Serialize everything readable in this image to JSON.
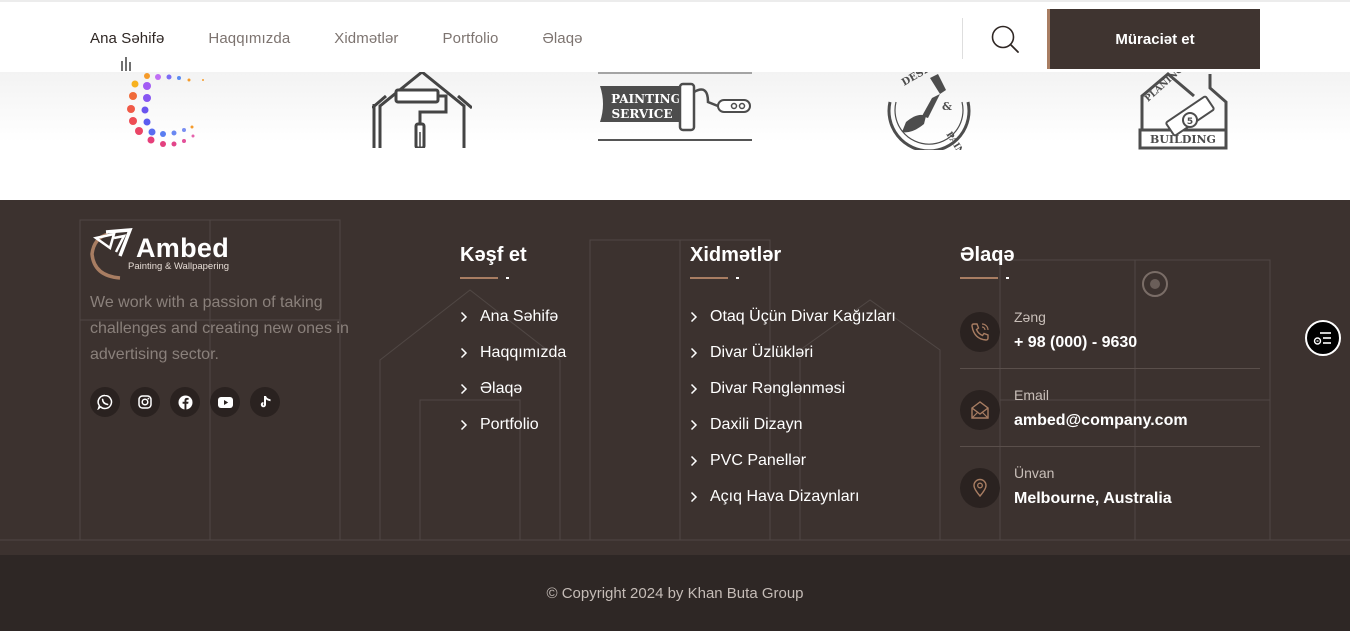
{
  "header": {
    "nav": [
      {
        "label": "Ana Səhifə",
        "active": true
      },
      {
        "label": "Haqqımızda",
        "active": false
      },
      {
        "label": "Xidmətlər",
        "active": false
      },
      {
        "label": "Portfolio",
        "active": false
      },
      {
        "label": "Əlaqə",
        "active": false
      }
    ],
    "cta_label": "Müraciət et"
  },
  "partners": [
    {
      "name": "colorful-dots-logo"
    },
    {
      "name": "house-roller-logo"
    },
    {
      "name": "painting-service-logo",
      "text": "PAINTING SERVICE"
    },
    {
      "name": "design-painting-logo",
      "text_top": "DESIGN",
      "text_mid": "&",
      "text_bottom": "PAINTING"
    },
    {
      "name": "planing-building-logo",
      "text_top": "PLANING",
      "text_bottom": "BUILDING"
    }
  ],
  "footer": {
    "brand": {
      "name": "Ambed",
      "tagline": "Painting & Wallpapering"
    },
    "about": "We work with a passion of taking challenges and creating new ones in advertising sector.",
    "socials": [
      "whatsapp-icon",
      "instagram-icon",
      "facebook-icon",
      "youtube-icon",
      "tiktok-icon"
    ],
    "explore": {
      "title": "Kəşf et",
      "links": [
        "Ana Səhifə",
        "Haqqımızda",
        "Əlaqə",
        "Portfolio"
      ]
    },
    "services": {
      "title": "Xidmətlər",
      "links": [
        "Otaq Üçün Divar Kağızları",
        "Divar Üzlükləri",
        "Divar Rənglənməsi",
        "Daxili Dizayn",
        "PVC Panellər",
        "Açıq Hava Dizaynları"
      ]
    },
    "contact": {
      "title": "Əlaqə",
      "phone_label": "Zəng",
      "phone": "+ 98 (000) - 9630",
      "email_label": "Email",
      "email": "ambed@company.com",
      "address_label": "Ünvan",
      "address": "Melbourne, Australia"
    },
    "copyright": "© Copyright 2024 by Khan Buta Group"
  },
  "colors": {
    "accent": "#a87d62",
    "footer_bg": "#3c322f",
    "copyright_bg": "#2e2725",
    "cta_bg": "#3f3430"
  }
}
